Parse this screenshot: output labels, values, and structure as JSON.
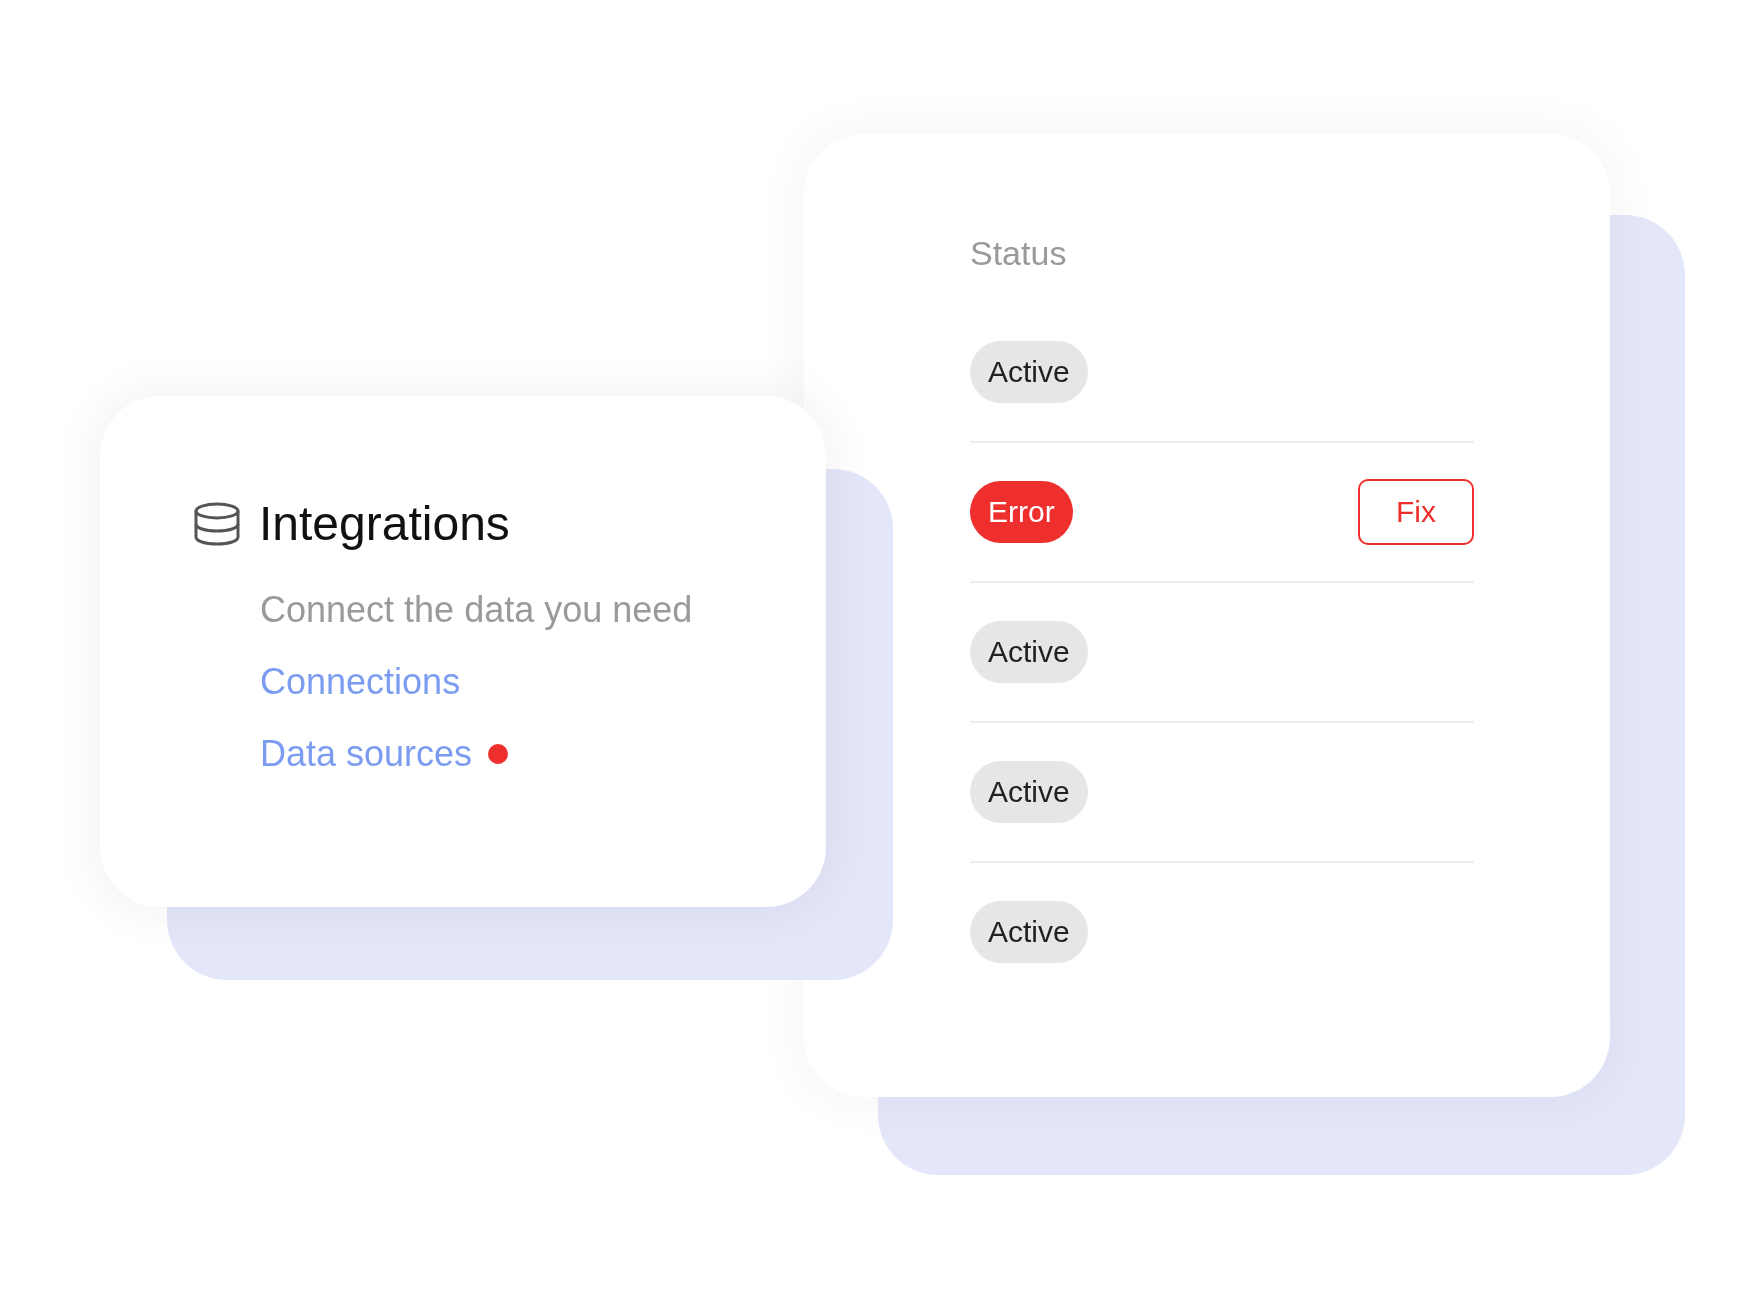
{
  "integrations": {
    "title": "Integrations",
    "subtitle": "Connect the data you need",
    "links": [
      {
        "label": "Connections",
        "alert": false
      },
      {
        "label": "Data sources",
        "alert": true
      }
    ]
  },
  "status": {
    "heading": "Status",
    "rows": [
      {
        "status": "Active",
        "kind": "active"
      },
      {
        "status": "Error",
        "kind": "error",
        "action": "Fix"
      },
      {
        "status": "Active",
        "kind": "active"
      },
      {
        "status": "Active",
        "kind": "active"
      },
      {
        "status": "Active",
        "kind": "active"
      }
    ]
  }
}
